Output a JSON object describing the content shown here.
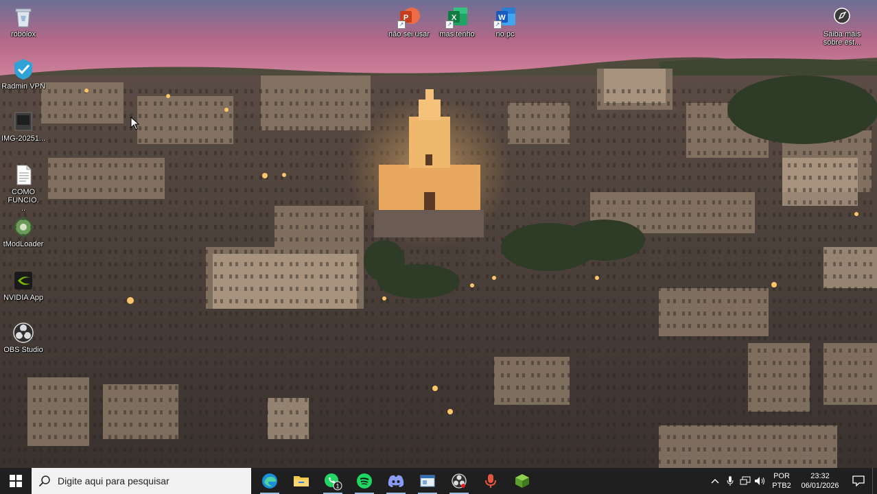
{
  "desktop": {
    "icons_left": [
      {
        "name": "robolox",
        "icon": "recycle-bin-icon"
      },
      {
        "name": "Radmin VPN",
        "icon": "radmin-vpn-icon"
      },
      {
        "name": "IMG-20251...",
        "icon": "image-file-icon"
      },
      {
        "name": "COMO FUNCIO...",
        "icon": "text-document-icon"
      },
      {
        "name": "tModLoader",
        "icon": "tmodloader-icon"
      },
      {
        "name": "NVIDIA App",
        "icon": "nvidia-icon"
      },
      {
        "name": "OBS Studio",
        "icon": "obs-icon"
      }
    ],
    "icons_top": [
      {
        "name": "não sei usar",
        "icon": "powerpoint-icon",
        "letter": "P"
      },
      {
        "name": "mas tenho",
        "icon": "excel-icon",
        "letter": "X"
      },
      {
        "name": "no pc",
        "icon": "word-icon",
        "letter": "W"
      }
    ],
    "icon_right": {
      "name": "Saiba mais sobre est...",
      "icon": "learn-more-icon"
    }
  },
  "taskbar": {
    "search_placeholder": "Digite aqui para pesquisar",
    "apps": [
      {
        "icon": "edge-icon"
      },
      {
        "icon": "file-explorer-icon"
      },
      {
        "icon": "whatsapp-icon",
        "badge": "1"
      },
      {
        "icon": "spotify-icon"
      },
      {
        "icon": "discord-icon"
      },
      {
        "icon": "window-app-icon"
      },
      {
        "icon": "obs-taskbar-icon"
      },
      {
        "icon": "microphone-app-icon"
      },
      {
        "icon": "green-cube-icon"
      }
    ],
    "language_line1": "POR",
    "language_line2": "PTB2",
    "time": "23:32",
    "date": "06/01/2026"
  },
  "colors": {
    "taskbar_bg": "#1f1f1f",
    "search_bg": "#f2f2f2",
    "sky_top": "#6b6d93",
    "sky_pink": "#c86a88"
  }
}
